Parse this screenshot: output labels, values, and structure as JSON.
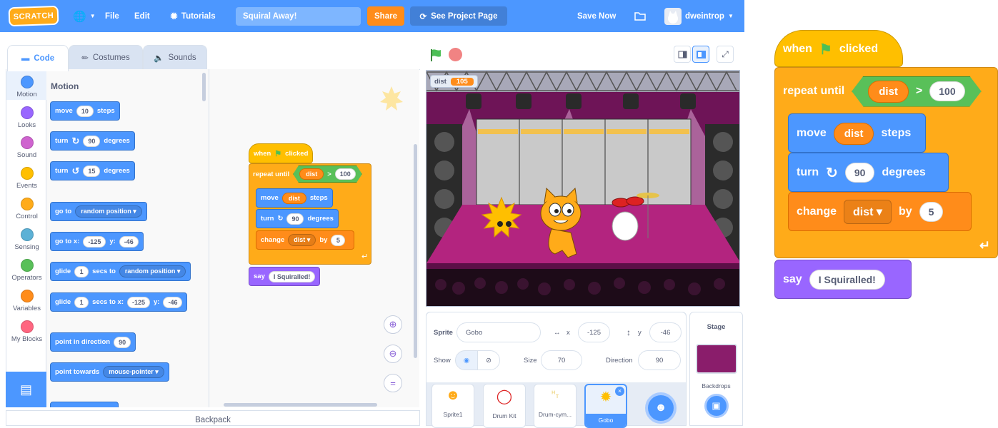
{
  "menubar": {
    "logo": "SCRATCH",
    "file": "File",
    "edit": "Edit",
    "tutorials": "Tutorials",
    "project_title": "Squiral Away!",
    "share": "Share",
    "see_project": "See Project Page",
    "save_now": "Save Now",
    "username": "dweintrop"
  },
  "tabs": {
    "code": "Code",
    "costumes": "Costumes",
    "sounds": "Sounds"
  },
  "categories": [
    {
      "label": "Motion",
      "color": "#4c97ff"
    },
    {
      "label": "Looks",
      "color": "#9966ff"
    },
    {
      "label": "Sound",
      "color": "#cf63cf"
    },
    {
      "label": "Events",
      "color": "#ffbf00"
    },
    {
      "label": "Control",
      "color": "#ffab19"
    },
    {
      "label": "Sensing",
      "color": "#5cb1d6"
    },
    {
      "label": "Operators",
      "color": "#59c059"
    },
    {
      "label": "Variables",
      "color": "#ff8c1a"
    },
    {
      "label": "My Blocks",
      "color": "#ff6680"
    }
  ],
  "palette": {
    "heading": "Motion",
    "move": {
      "a": "move",
      "v": "10",
      "b": "steps"
    },
    "turn_right": {
      "a": "turn",
      "v": "90",
      "b": "degrees"
    },
    "turn_left": {
      "a": "turn",
      "v": "15",
      "b": "degrees"
    },
    "goto": {
      "a": "go to",
      "v": "random position"
    },
    "gotoxy": {
      "a": "go to x:",
      "x": "-125",
      "b": "y:",
      "y": "-46"
    },
    "glide": {
      "a": "glide",
      "v": "1",
      "b": "secs to",
      "c": "random position"
    },
    "glidexy": {
      "a": "glide",
      "v": "1",
      "b": "secs to x:",
      "x": "-125",
      "c": "y:",
      "y": "-46"
    },
    "point_dir": {
      "a": "point in direction",
      "v": "90"
    },
    "point_towards": {
      "a": "point towards",
      "v": "mouse-pointer"
    }
  },
  "script": {
    "when": "when",
    "clicked": "clicked",
    "repeat": "repeat until",
    "var": "dist",
    "op": ">",
    "num": "100",
    "move": "move",
    "steps": "steps",
    "turn": "turn",
    "deg": "90",
    "degrees": "degrees",
    "change": "change",
    "by": "by",
    "inc": "5",
    "say": "say",
    "msg": "I Squiralled!"
  },
  "stage": {
    "monitor_label": "dist",
    "monitor_value": "105"
  },
  "sprite_info": {
    "sprite_label": "Sprite",
    "sprite_name": "Gobo",
    "x_label": "x",
    "x": "-125",
    "y_label": "y",
    "y": "-46",
    "show_label": "Show",
    "size_label": "Size",
    "size": "70",
    "direction_label": "Direction",
    "direction": "90"
  },
  "sprites": [
    "Sprite1",
    "Drum Kit",
    "Drum-cym...",
    "Gobo"
  ],
  "stage_pane": {
    "title": "Stage",
    "backdrops": "Backdrops"
  },
  "backpack": "Backpack"
}
